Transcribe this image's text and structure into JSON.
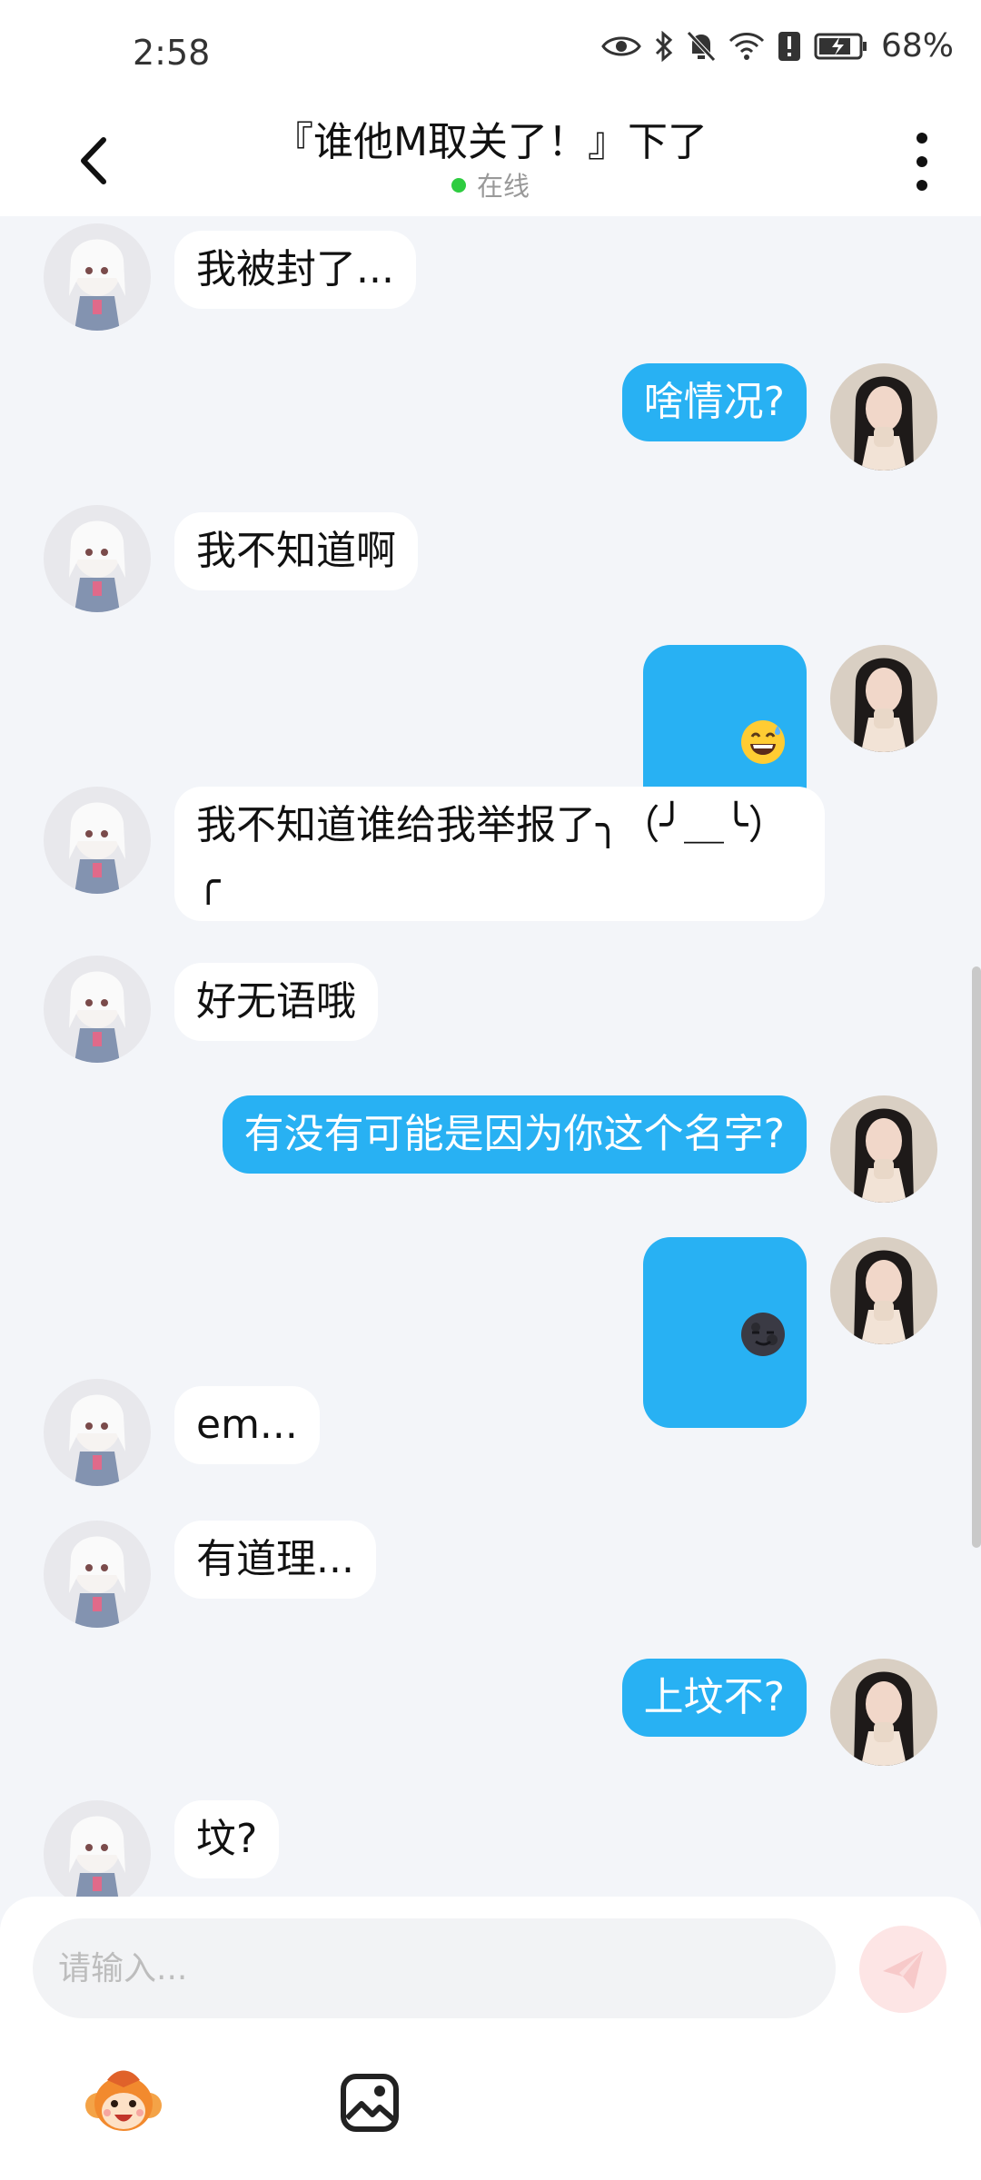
{
  "status_bar": {
    "time": "2:58",
    "battery": "68%",
    "icons": [
      "eye-icon",
      "bluetooth-icon",
      "mute-bell-icon",
      "wifi-icon",
      "alert-icon",
      "battery-icon"
    ]
  },
  "header": {
    "title": "『谁他M取关了！』下了",
    "status": "在线",
    "status_color": "#2ecc40"
  },
  "messages": [
    {
      "side": "in",
      "text": "我被封了..."
    },
    {
      "side": "out",
      "text": "啥情况?"
    },
    {
      "side": "in",
      "text": "我不知道啊"
    },
    {
      "side": "out",
      "emoji": "grinning-sweat-emoji"
    },
    {
      "side": "in",
      "text": "我不知道谁给我举报了╮（╯＿╰）╭"
    },
    {
      "side": "in",
      "text": "好无语哦"
    },
    {
      "side": "out",
      "text": "有没有可能是因为你这个名字?"
    },
    {
      "side": "out",
      "emoji": "new-moon-face-emoji"
    },
    {
      "side": "in",
      "text": "em..."
    },
    {
      "side": "in",
      "text": "有道理..."
    },
    {
      "side": "out",
      "text": "上坟不?"
    },
    {
      "side": "in",
      "text": "坟?"
    }
  ],
  "composer": {
    "placeholder": "请输入...",
    "accent": "#28b1f3"
  }
}
